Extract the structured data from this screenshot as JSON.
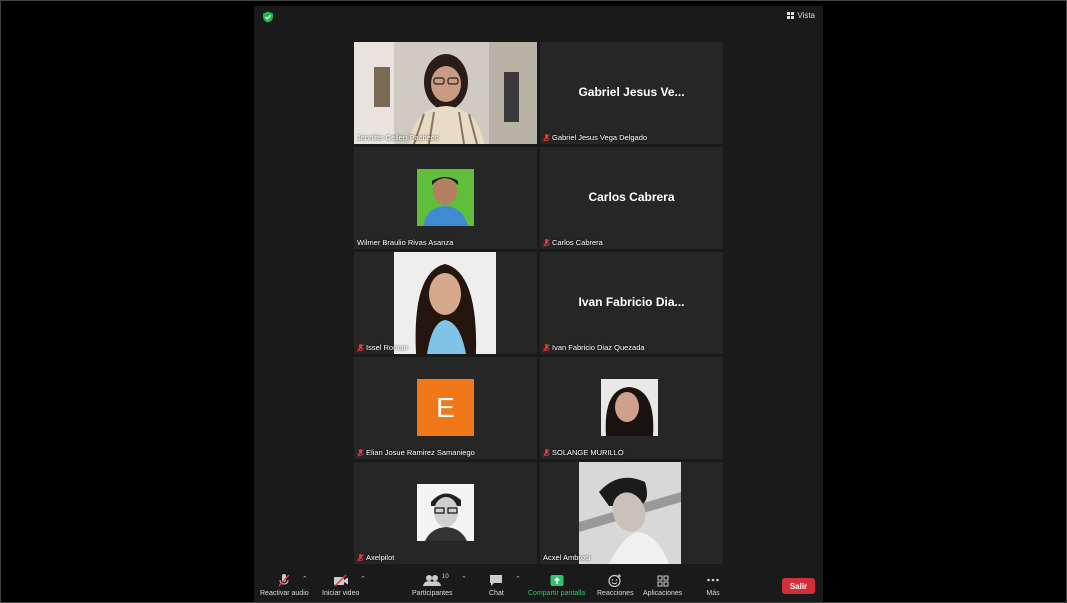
{
  "topbar": {
    "view_label": "Vista"
  },
  "tiles": [
    {
      "name": "Jennifer Celleri-Pacheco",
      "muted": false,
      "display": ""
    },
    {
      "name": "Gabriel Jesus Vega Delgado",
      "muted": true,
      "display": "Gabriel Jesus Ve..."
    },
    {
      "name": "Wilmer Braulio Rivas Asanza",
      "muted": false,
      "display": ""
    },
    {
      "name": "Carlos Cabrera",
      "muted": true,
      "display": "Carlos Cabrera"
    },
    {
      "name": "Issel Roman",
      "muted": true,
      "display": ""
    },
    {
      "name": "Ivan Fabricio Diaz Quezada",
      "muted": true,
      "display": "Ivan Fabricio Dia..."
    },
    {
      "name": "Elian Josue Ramirez Samaniego",
      "muted": true,
      "display": "",
      "avatar_letter": "E"
    },
    {
      "name": "SOLANGE MURILLO",
      "muted": true,
      "display": ""
    },
    {
      "name": "Axelpilot",
      "muted": true,
      "display": ""
    },
    {
      "name": "Acxel Ambrosi",
      "muted": false,
      "display": ""
    }
  ],
  "toolbar": {
    "audio_label": "Reactivar audio",
    "video_label": "Iniciar video",
    "participants_label": "Participantes",
    "participants_count": "10",
    "chat_label": "Chat",
    "share_label": "Compartir pantalla",
    "reactions_label": "Reacciones",
    "apps_label": "Aplicaciones",
    "more_label": "Más",
    "leave_label": "Salir"
  },
  "colors": {
    "active_speaker": "#c7d45e",
    "share_green": "#2fc66b",
    "leave_red": "#d32f3a",
    "avatar_orange": "#f07818"
  }
}
